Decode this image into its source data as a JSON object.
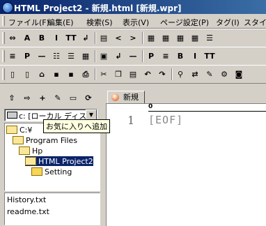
{
  "window": {
    "title": "HTML Project2 - 新規.html [新規.wpr]"
  },
  "menu": [
    "ファイル(F)",
    "編集(E)",
    "検索(S)",
    "表示(V)",
    "ページ設定(P)",
    "タグ(I)",
    "スタイル"
  ],
  "toolbar1": [
    {
      "icon": "arrows-icon",
      "glyph": "⇔"
    },
    {
      "icon": "strike-a-icon",
      "glyph": "A"
    },
    {
      "icon": "bold-icon",
      "glyph": "B"
    },
    {
      "icon": "italic-icon",
      "glyph": "I"
    },
    {
      "icon": "teletype-icon",
      "glyph": "TT"
    },
    {
      "icon": "return-icon",
      "glyph": "↲"
    },
    {
      "icon": "list-icon",
      "glyph": "▤"
    },
    {
      "icon": "left-angle-icon",
      "glyph": "<"
    },
    {
      "icon": "right-angle-icon",
      "glyph": ">"
    },
    {
      "icon": "table-icon",
      "glyph": "▦"
    },
    {
      "icon": "table2-icon",
      "glyph": "▦"
    },
    {
      "icon": "table3-icon",
      "glyph": "▦"
    },
    {
      "icon": "table4-icon",
      "glyph": "▦"
    },
    {
      "icon": "list2-icon",
      "glyph": "☰"
    }
  ],
  "toolbar2": [
    {
      "icon": "align-icon",
      "glyph": "≡"
    },
    {
      "icon": "paragraph-icon",
      "glyph": "P"
    },
    {
      "icon": "hr-icon",
      "glyph": "—"
    },
    {
      "icon": "bullet-list-icon",
      "glyph": "☷"
    },
    {
      "icon": "numbered-list-icon",
      "glyph": "☰"
    },
    {
      "icon": "grid-icon",
      "glyph": "▦"
    },
    {
      "icon": "image-icon",
      "glyph": "▣"
    },
    {
      "icon": "break-icon",
      "glyph": "↲"
    },
    {
      "icon": "line-icon",
      "glyph": "—"
    },
    {
      "icon": "p-icon",
      "glyph": "P"
    },
    {
      "icon": "align-right-icon",
      "glyph": "≡"
    },
    {
      "icon": "bold2-icon",
      "glyph": "B"
    },
    {
      "icon": "italic2-icon",
      "glyph": "I"
    },
    {
      "icon": "teletype2-icon",
      "glyph": "TT"
    }
  ],
  "toolbar3": [
    {
      "icon": "new-icon",
      "glyph": "▯"
    },
    {
      "icon": "new2-icon",
      "glyph": "▯"
    },
    {
      "icon": "open-icon",
      "glyph": "⌂"
    },
    {
      "icon": "save-icon",
      "glyph": "▪"
    },
    {
      "icon": "saveall-icon",
      "glyph": "▪"
    },
    {
      "icon": "print-icon",
      "glyph": "⎙"
    },
    {
      "icon": "cut-icon",
      "glyph": "✂"
    },
    {
      "icon": "copy-icon",
      "glyph": "❐"
    },
    {
      "icon": "paste-icon",
      "glyph": "▤"
    },
    {
      "icon": "undo-icon",
      "glyph": "↶"
    },
    {
      "icon": "redo-icon",
      "glyph": "↷"
    },
    {
      "icon": "find-icon",
      "glyph": "⚲"
    },
    {
      "icon": "replace-icon",
      "glyph": "⇄"
    },
    {
      "icon": "grep-icon",
      "glyph": "✎"
    },
    {
      "icon": "settings-icon",
      "glyph": "⚙"
    },
    {
      "icon": "view-icon",
      "glyph": "◙"
    }
  ],
  "sidebar": {
    "toolbar": [
      {
        "icon": "up-folder-icon",
        "glyph": "⇧"
      },
      {
        "icon": "forward-icon",
        "glyph": "⇨"
      },
      {
        "icon": "add-favorite-icon",
        "glyph": "+"
      },
      {
        "icon": "edit-favorite-icon",
        "glyph": "✎"
      },
      {
        "icon": "favorite-folder-icon",
        "glyph": "▭"
      },
      {
        "icon": "refresh-icon",
        "glyph": "⟳"
      }
    ],
    "drive": "c: [ローカル ディスク",
    "tooltip": "お気に入りへ追加",
    "tree": [
      {
        "label": "C:¥",
        "indent": 0,
        "open": true,
        "selected": false
      },
      {
        "label": "Program Files",
        "indent": 1,
        "open": true,
        "selected": false
      },
      {
        "label": "Hp",
        "indent": 2,
        "open": true,
        "selected": false
      },
      {
        "label": "HTML Project2",
        "indent": 3,
        "open": true,
        "selected": true
      },
      {
        "label": "Setting",
        "indent": 4,
        "open": false,
        "selected": false
      }
    ],
    "files": [
      "History.txt",
      "readme.txt"
    ]
  },
  "editor": {
    "tab": "新規",
    "ruler_zero": "0",
    "line_number": "1",
    "content": "[EOF]"
  }
}
